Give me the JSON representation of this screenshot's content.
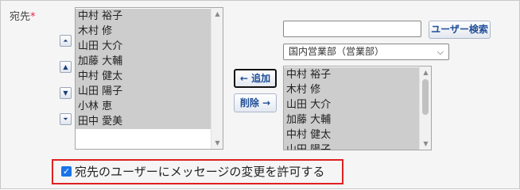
{
  "field": {
    "label": "宛先",
    "required_mark": "*"
  },
  "selected_list": {
    "items": [
      "中村 裕子",
      "木村 修",
      "山田 大介",
      "加藤 大輔",
      "中村 健太",
      "山田 陽子",
      "小林 恵",
      "田中 愛美"
    ]
  },
  "order_buttons": {
    "top": "⏫",
    "up": "▲",
    "down": "▼",
    "bottom": "⏬"
  },
  "transfer": {
    "add_label": "← 追加",
    "remove_label": "削除 →"
  },
  "search": {
    "input_value": "",
    "button_label": "ユーザー検索"
  },
  "group_select": {
    "selected": "国内営業部（営業部）"
  },
  "candidate_list": {
    "items": [
      "中村 裕子",
      "木村 修",
      "山田 大介",
      "加藤 大輔",
      "中村 健太",
      "山田 陽子"
    ]
  },
  "permission": {
    "checked": true,
    "label": "宛先のユーザーにメッセージの変更を許可する"
  }
}
